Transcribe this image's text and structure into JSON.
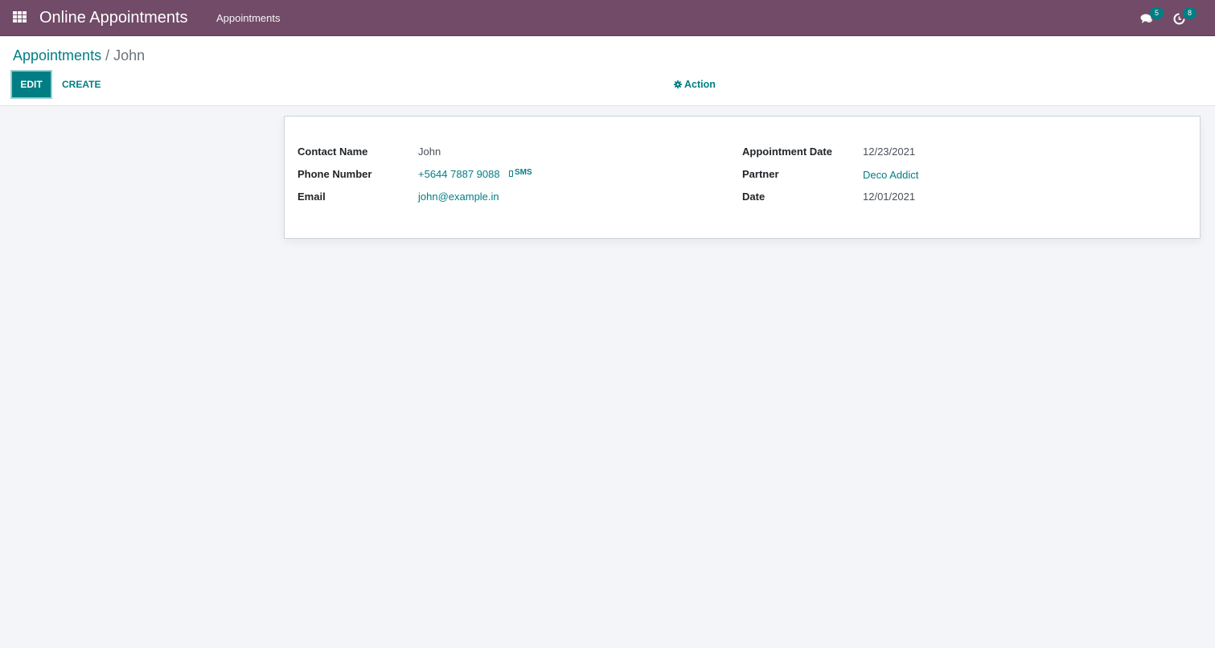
{
  "navbar": {
    "app_title": "Online Appointments",
    "menu": [
      {
        "label": "Appointments"
      }
    ],
    "systray": {
      "messages_count": "5",
      "activities_count": "8"
    }
  },
  "breadcrumb": {
    "parent": "Appointments",
    "separator": "/",
    "current": "John"
  },
  "control_panel": {
    "edit_label": "EDIT",
    "create_label": "CREATE",
    "action_label": "Action"
  },
  "form": {
    "left": [
      {
        "label": "Contact Name",
        "value": "John"
      },
      {
        "label": "Phone Number",
        "value": "+5644 7887 9088",
        "sms_label": "SMS"
      },
      {
        "label": "Email",
        "value": "john@example.in"
      }
    ],
    "right": [
      {
        "label": "Appointment Date",
        "value": "12/23/2021"
      },
      {
        "label": "Partner",
        "value": "Deco Addict"
      },
      {
        "label": "Date",
        "value": "12/01/2021"
      }
    ]
  },
  "colors": {
    "navbar": "#714b67",
    "accent": "#017e84"
  }
}
